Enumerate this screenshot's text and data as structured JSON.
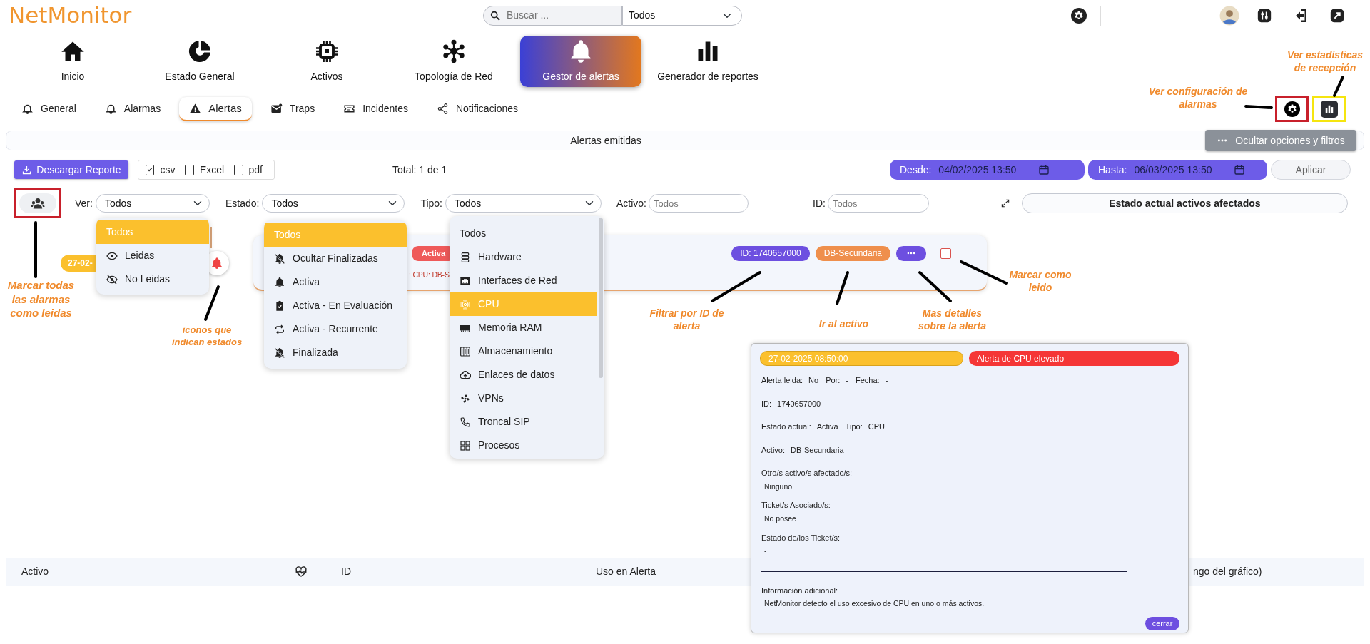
{
  "app": {
    "logo": "NetMonitor",
    "search": {
      "placeholder": "Buscar ...",
      "scope": "Todos"
    }
  },
  "main_nav": [
    {
      "label": "Inicio",
      "selected": false
    },
    {
      "label": "Estado General",
      "selected": false
    },
    {
      "label": "Activos",
      "selected": false
    },
    {
      "label": "Topología de Red",
      "selected": false
    },
    {
      "label": "Gestor de alertas",
      "selected": true
    },
    {
      "label": "Generador de reportes",
      "selected": false
    }
  ],
  "sub_tabs": [
    {
      "label": "General",
      "selected": false
    },
    {
      "label": "Alarmas",
      "selected": false
    },
    {
      "label": "Alertas",
      "selected": true
    },
    {
      "label": "Traps",
      "selected": false
    },
    {
      "label": "Incidentes",
      "selected": false
    },
    {
      "label": "Notificaciones",
      "selected": false
    }
  ],
  "header_bar": {
    "title": "Alertas emitidas",
    "toggle_button": "Ocultar opciones y filtros"
  },
  "toolbar": {
    "download_button": "Descargar Reporte",
    "formats": [
      {
        "label": "csv",
        "checked": true
      },
      {
        "label": "Excel",
        "checked": false
      },
      {
        "label": "pdf",
        "checked": false
      }
    ],
    "total": "Total: 1 de 1",
    "from": {
      "label": "Desde:",
      "value": "04/02/2025 13:50"
    },
    "to": {
      "label": "Hasta:",
      "value": "06/03/2025 13:50"
    },
    "apply_button": "Aplicar"
  },
  "filters": {
    "view": {
      "label": "Ver:",
      "value": "Todos"
    },
    "state": {
      "label": "Estado:",
      "value": "Todos"
    },
    "type": {
      "label": "Tipo:",
      "value": "Todos"
    },
    "asset": {
      "label": "Activo:",
      "placeholder": "Todos"
    },
    "id": {
      "label": "ID:",
      "placeholder": "Todos"
    },
    "affected_button": "Estado actual activos afectados"
  },
  "view_menu": [
    {
      "label": "Todos",
      "selected": true
    },
    {
      "label": "Leidas",
      "selected": false
    },
    {
      "label": "No Leidas",
      "selected": false
    }
  ],
  "state_menu": [
    {
      "label": "Todos",
      "selected": true
    },
    {
      "label": "Ocultar Finalizadas",
      "selected": false
    },
    {
      "label": "Activa",
      "selected": false
    },
    {
      "label": "Activa - En Evaluación",
      "selected": false
    },
    {
      "label": "Activa - Recurrente",
      "selected": false
    },
    {
      "label": "Finalizada",
      "selected": false
    }
  ],
  "type_menu": [
    {
      "label": "Todos",
      "selected": false
    },
    {
      "label": "Hardware",
      "selected": false
    },
    {
      "label": "Interfaces de Red",
      "selected": false
    },
    {
      "label": "CPU",
      "selected": true
    },
    {
      "label": "Memoria RAM",
      "selected": false
    },
    {
      "label": "Almacenamiento",
      "selected": false
    },
    {
      "label": "Enlaces de datos",
      "selected": false
    },
    {
      "label": "VPNs",
      "selected": false
    },
    {
      "label": "Troncal SIP",
      "selected": false
    },
    {
      "label": "Procesos",
      "selected": false
    }
  ],
  "alert": {
    "date": "27-02-",
    "status": "Activa",
    "detail": ": CPU: DB-S",
    "id_badge": "ID: 1740657000",
    "asset_badge": "DB-Secundaria",
    "read": false
  },
  "detail_popup": {
    "date": "27-02-2025 08:50:00",
    "title": "Alerta de CPU elevado",
    "rows": [
      {
        "kind": "inline",
        "pairs": [
          {
            "label": "Alerta leida:",
            "value": "No"
          },
          {
            "label": "Por:",
            "value": "-"
          },
          {
            "label": "Fecha:",
            "value": "-"
          }
        ]
      },
      {
        "kind": "inline",
        "pairs": [
          {
            "label": "ID:",
            "value": "1740657000"
          }
        ]
      },
      {
        "kind": "inline",
        "pairs": [
          {
            "label": "Estado actual:",
            "value": "Activa"
          },
          {
            "label": "Tipo:",
            "value": "CPU"
          }
        ]
      },
      {
        "kind": "inline",
        "pairs": [
          {
            "label": "Activo:",
            "value": "DB-Secundaria"
          }
        ]
      },
      {
        "kind": "block",
        "label": "Otro/s activo/s afectado/s:",
        "value": "Ninguno"
      },
      {
        "kind": "block",
        "label": "Ticket/s Asociado/s:",
        "value": "No posee"
      },
      {
        "kind": "block",
        "label": "Estado de/los Ticket/s:",
        "value": "-"
      },
      {
        "kind": "divider"
      },
      {
        "kind": "block",
        "label": "Información adicional:",
        "value": "NetMonitor detecto el uso excesivo de CPU en uno o más activos."
      }
    ],
    "close_button": "cerrar"
  },
  "table": {
    "columns": [
      {
        "kind": "text",
        "label": "Activo"
      },
      {
        "kind": "icon"
      },
      {
        "kind": "text",
        "label": "ID"
      },
      {
        "kind": "text",
        "label": "Uso en Alerta"
      },
      {
        "kind": "text",
        "label": "ngo del gráfico)"
      }
    ]
  },
  "annotations": [
    "Ver estadísticas de recepción",
    "Ver configuración de alarmas",
    "Marcar todas las alarmas como leidas",
    "iconos que indican estados",
    "Filtrar por ID de alerta",
    "Ir al activo",
    "Mas detalles sobre la alerta",
    "Marcar como leido"
  ]
}
